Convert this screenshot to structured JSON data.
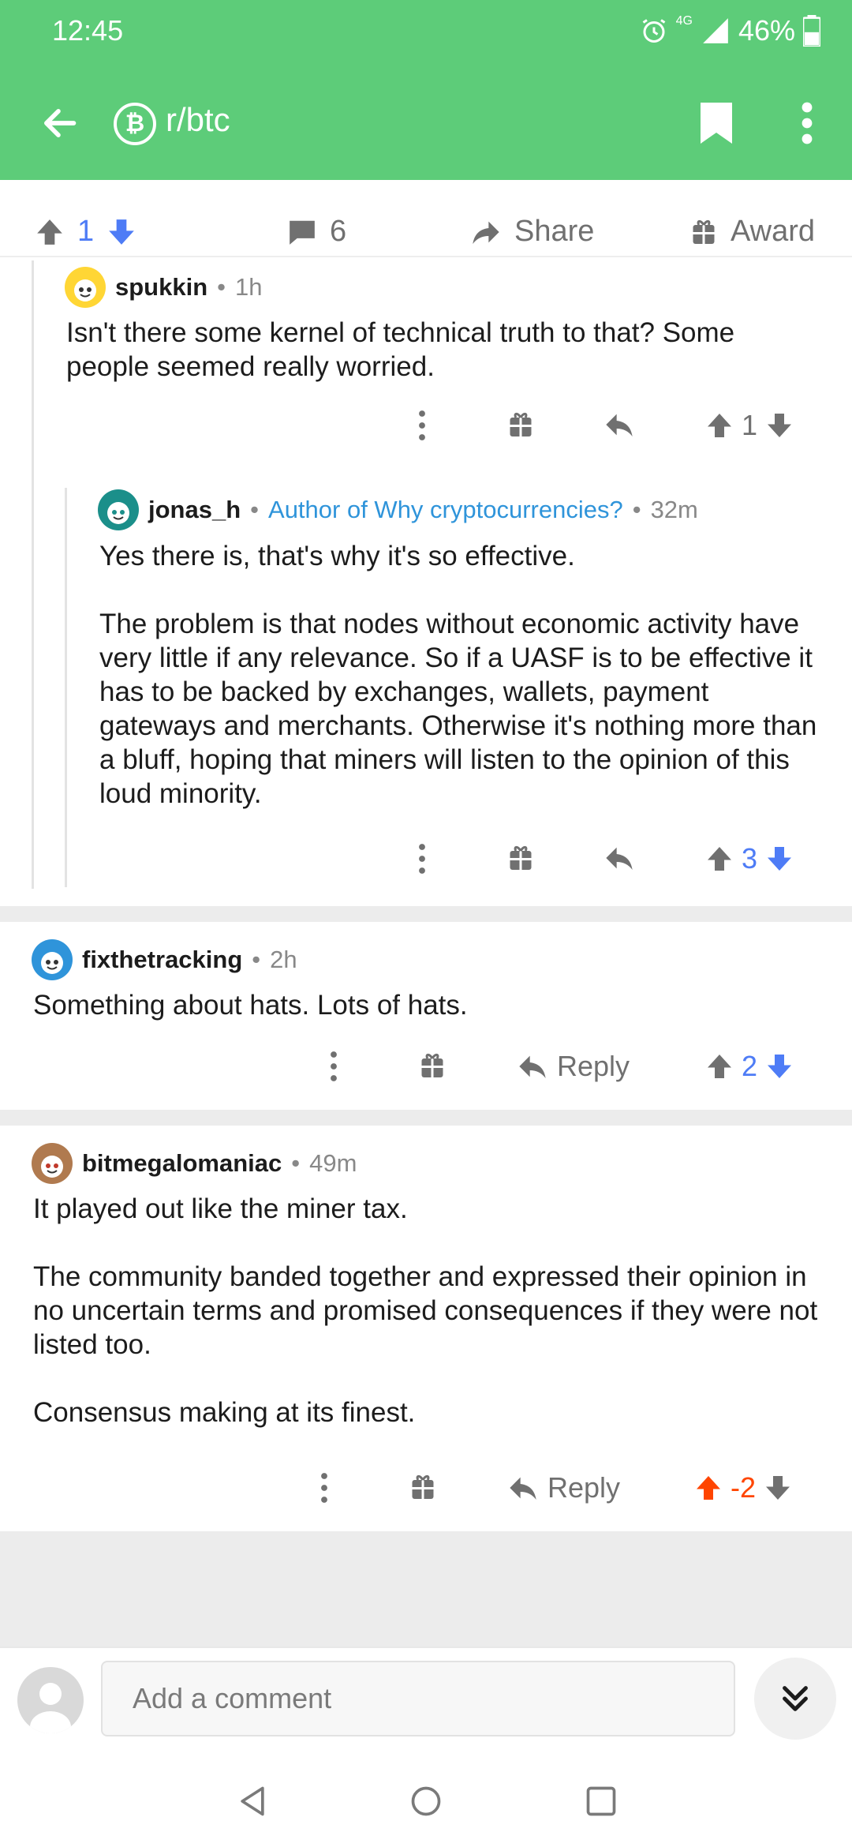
{
  "status_bar": {
    "time": "12:45",
    "network": "4G",
    "battery": "46%"
  },
  "header": {
    "subreddit": "r/btc",
    "subreddit_icon": "bitcoin-icon",
    "back_icon": "arrow-left-icon"
  },
  "post_actions": {
    "score": "1",
    "comments": "6",
    "share_label": "Share",
    "award_label": "Award"
  },
  "comments": [
    {
      "user": "spukkin",
      "flair": "",
      "time": "1h",
      "body": [
        "Isn't there some kernel of technical truth to that? Some people seemed really worried."
      ],
      "score": "1",
      "reply_label": ""
    },
    {
      "user": "jonas_h",
      "flair": "Author of Why cryptocurrencies?",
      "time": "32m",
      "body": [
        "Yes there is, that's why it's so effective.",
        "The problem is that nodes without economic activity have very little if any relevance. So if a UASF is to be effective it has to be backed by exchanges, wallets, payment gateways and merchants. Otherwise it's nothing more than a bluff, hoping that miners will listen to the opinion of this loud minority."
      ],
      "score": "3",
      "reply_label": ""
    },
    {
      "user": "fixthetracking",
      "flair": "",
      "time": "2h",
      "body": [
        "Something about hats. Lots of hats."
      ],
      "score": "2",
      "reply_label": "Reply"
    },
    {
      "user": "bitmegalomaniac",
      "flair": "",
      "time": "49m",
      "body": [
        "It played out like the miner tax.",
        "The community banded together and expressed their opinion in no uncertain terms and promised consequences if they were not listed too.",
        "Consensus making at its finest."
      ],
      "score": "-2",
      "reply_label": "Reply"
    }
  ],
  "composer": {
    "placeholder": "Add a comment"
  },
  "colors": {
    "header": "#5dcc79",
    "upvote_orange": "#ff4500",
    "downvote_blue": "#4e7cf6",
    "flair_blue": "#2f94da"
  }
}
